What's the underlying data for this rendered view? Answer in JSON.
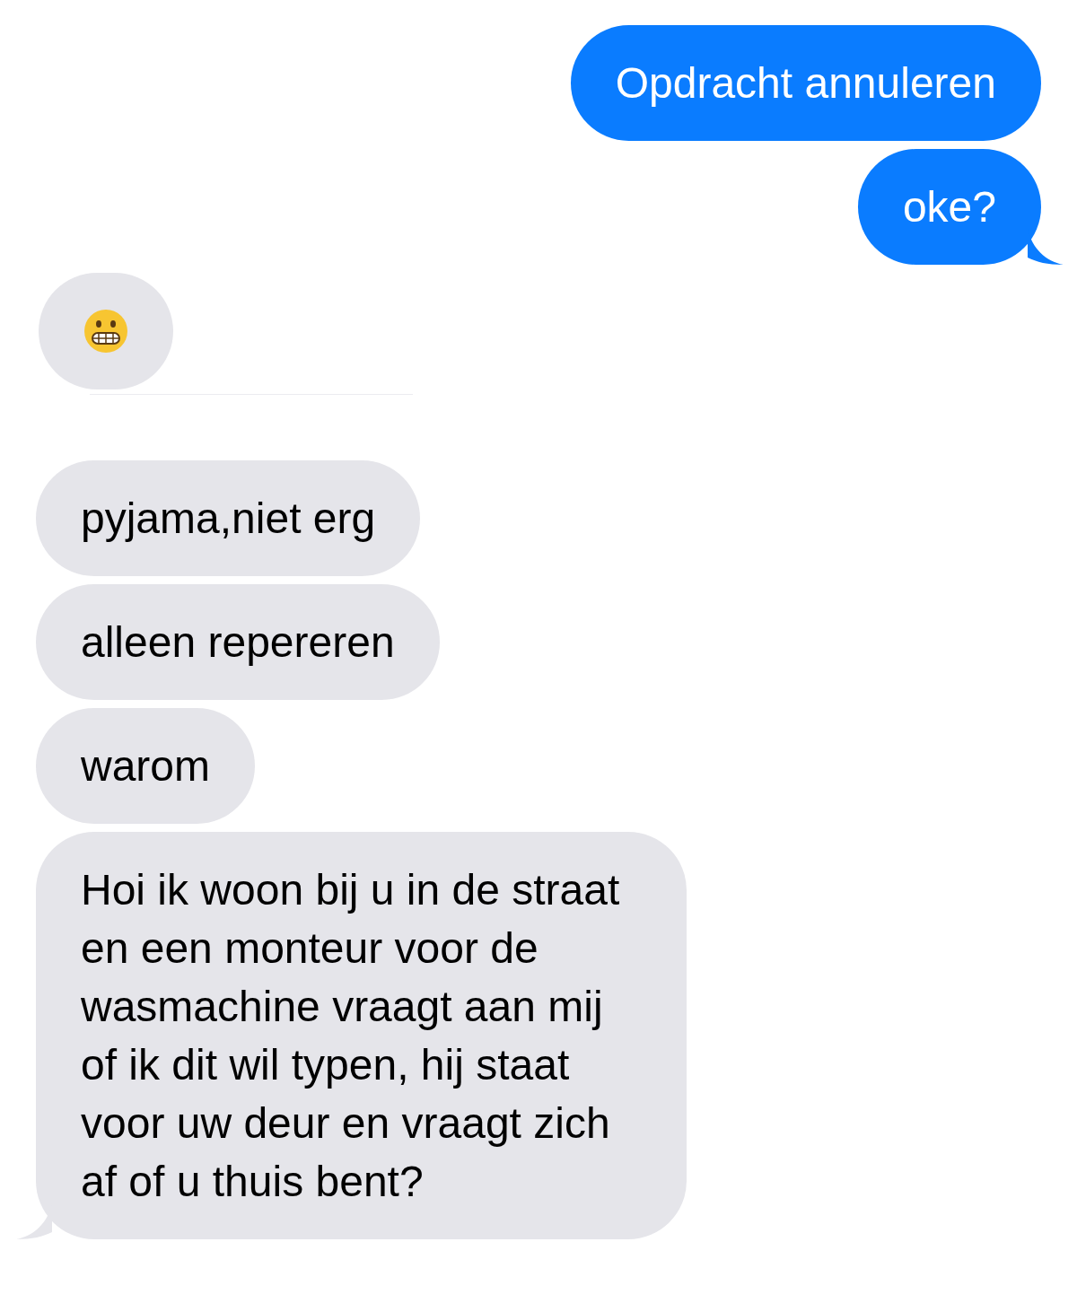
{
  "messages": [
    {
      "kind": "outgoing",
      "text": "Opdracht annuleren",
      "tail": false
    },
    {
      "kind": "outgoing",
      "text": "oke?",
      "tail": true
    },
    {
      "kind": "emoji",
      "tail": false
    },
    {
      "kind": "incoming",
      "text": "pyjama,niet erg",
      "tail": false
    },
    {
      "kind": "incoming",
      "text": "alleen repereren",
      "tail": false
    },
    {
      "kind": "incoming",
      "text": "warom",
      "tail": false
    },
    {
      "kind": "incoming",
      "text": "Hoi ik woon bij u in de straat en een monteur voor de wasmachine vraagt aan mij of ik dit wil typen, hij staat voor uw deur en vraagt zich af of u thuis bent?",
      "tail": true
    }
  ]
}
